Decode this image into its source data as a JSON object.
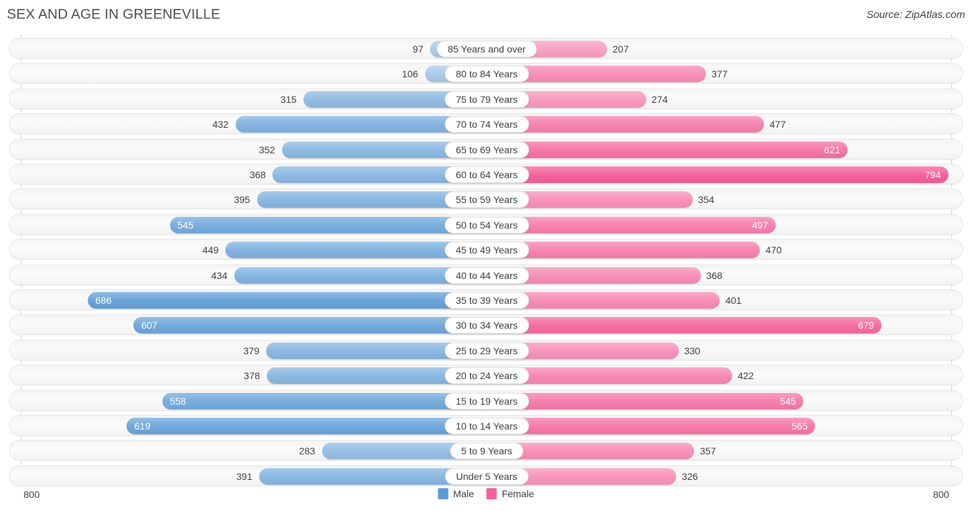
{
  "header": {
    "title": "SEX AND AGE IN GREENEVILLE",
    "source": "Source: ZipAtlas.com"
  },
  "legend": {
    "male_label": "Male",
    "female_label": "Female",
    "male_color": "#5B9BD5",
    "female_color": "#F4609A"
  },
  "axis": {
    "left_max_label": "800",
    "right_max_label": "800",
    "max": 800
  },
  "chart_data": {
    "type": "bar",
    "title": "SEX AND AGE IN GREENEVILLE",
    "subtitle": "Source: ZipAtlas.com",
    "orientation": "horizontal-diverging",
    "xlabel": "",
    "ylabel": "",
    "xlim": [
      800,
      800
    ],
    "grid": false,
    "legend_position": "bottom-center",
    "categories": [
      "85 Years and over",
      "80 to 84 Years",
      "75 to 79 Years",
      "70 to 74 Years",
      "65 to 69 Years",
      "60 to 64 Years",
      "55 to 59 Years",
      "50 to 54 Years",
      "45 to 49 Years",
      "40 to 44 Years",
      "35 to 39 Years",
      "30 to 34 Years",
      "25 to 29 Years",
      "20 to 24 Years",
      "15 to 19 Years",
      "10 to 14 Years",
      "5 to 9 Years",
      "Under 5 Years"
    ],
    "series": [
      {
        "name": "Male",
        "color": "#5B9BD5",
        "values": [
          97,
          106,
          315,
          432,
          352,
          368,
          395,
          545,
          449,
          434,
          686,
          607,
          379,
          378,
          558,
          619,
          283,
          391
        ]
      },
      {
        "name": "Female",
        "color": "#F4609A",
        "values": [
          207,
          377,
          274,
          477,
          621,
          794,
          354,
          497,
          470,
          368,
          401,
          679,
          330,
          422,
          545,
          565,
          357,
          326
        ]
      }
    ]
  },
  "rows": [
    {
      "label": "85 Years and over",
      "male": 97,
      "female": 207
    },
    {
      "label": "80 to 84 Years",
      "male": 106,
      "female": 377
    },
    {
      "label": "75 to 79 Years",
      "male": 315,
      "female": 274
    },
    {
      "label": "70 to 74 Years",
      "male": 432,
      "female": 477
    },
    {
      "label": "65 to 69 Years",
      "male": 352,
      "female": 621
    },
    {
      "label": "60 to 64 Years",
      "male": 368,
      "female": 794
    },
    {
      "label": "55 to 59 Years",
      "male": 395,
      "female": 354
    },
    {
      "label": "50 to 54 Years",
      "male": 545,
      "female": 497
    },
    {
      "label": "45 to 49 Years",
      "male": 449,
      "female": 470
    },
    {
      "label": "40 to 44 Years",
      "male": 434,
      "female": 368
    },
    {
      "label": "35 to 39 Years",
      "male": 686,
      "female": 401
    },
    {
      "label": "30 to 34 Years",
      "male": 607,
      "female": 679
    },
    {
      "label": "25 to 29 Years",
      "male": 379,
      "female": 330
    },
    {
      "label": "20 to 24 Years",
      "male": 378,
      "female": 422
    },
    {
      "label": "15 to 19 Years",
      "male": 558,
      "female": 545
    },
    {
      "label": "10 to 14 Years",
      "male": 619,
      "female": 565
    },
    {
      "label": "5 to 9 Years",
      "male": 283,
      "female": 357
    },
    {
      "label": "Under 5 Years",
      "male": 391,
      "female": 326
    }
  ]
}
